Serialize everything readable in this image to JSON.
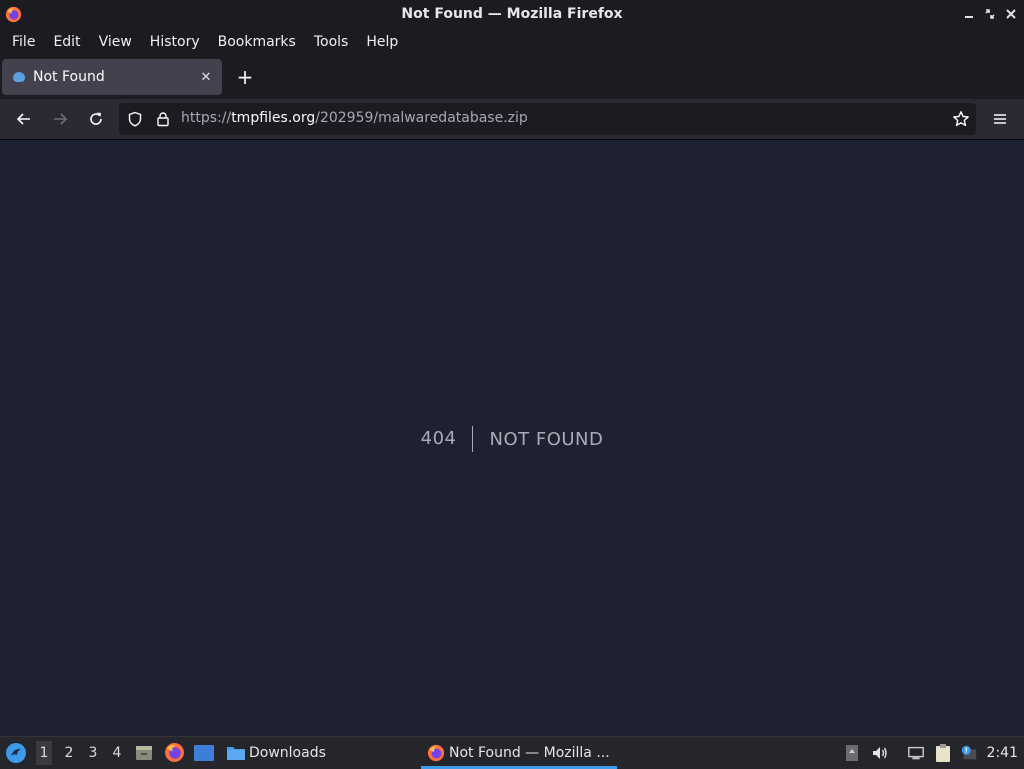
{
  "window": {
    "title": "Not Found — Mozilla Firefox",
    "controls": {
      "minimize": "minimize-icon",
      "maximize": "maximize-icon",
      "close": "close-icon"
    }
  },
  "menubar": {
    "items": [
      {
        "label": "File"
      },
      {
        "label": "Edit"
      },
      {
        "label": "View"
      },
      {
        "label": "History"
      },
      {
        "label": "Bookmarks"
      },
      {
        "label": "Tools"
      },
      {
        "label": "Help"
      }
    ]
  },
  "tabs": [
    {
      "title": "Not Found",
      "active": true
    }
  ],
  "navbar": {
    "url_scheme": "https://",
    "url_host": "tmpfiles.org",
    "url_path": "/202959/malwaredatabase.zip"
  },
  "page": {
    "error_code": "404",
    "error_message": "NOT FOUND"
  },
  "taskbar": {
    "workspaces": [
      "1",
      "2",
      "3",
      "4"
    ],
    "active_workspace": "1",
    "downloads_label": "Downloads",
    "active_task_label": "Not Found — Mozilla ...",
    "clock": "2:41"
  },
  "colors": {
    "accent": "#3d9ae8",
    "content_bg": "#1e2130",
    "chrome_bg": "#1c1b22"
  }
}
